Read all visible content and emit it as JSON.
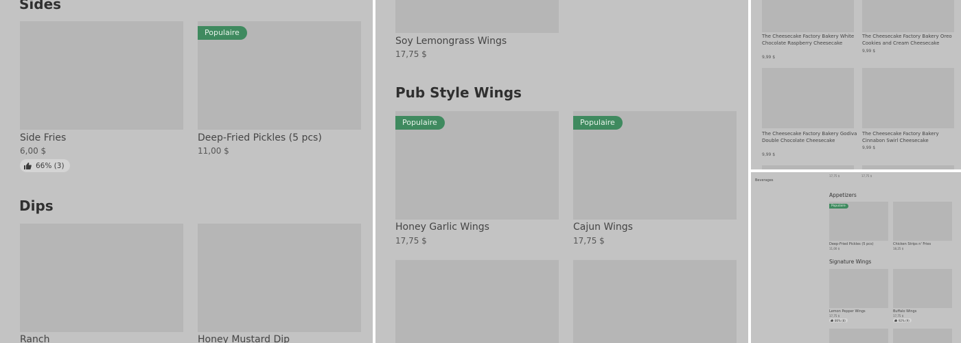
{
  "panel1": {
    "sides_title": "Sides",
    "dips_title": "Dips",
    "popular_badge": "Populaire",
    "side_fries": {
      "name": "Side Fries",
      "price": "6,00 $",
      "rating": "66% (3)"
    },
    "deep_fried_pickles": {
      "name": "Deep-Fried Pickles (5 pcs)",
      "price": "11,00 $"
    },
    "ranch": {
      "name": "Ranch"
    },
    "honey_mustard_dip": {
      "name": "Honey Mustard Dip"
    }
  },
  "panel2": {
    "soy_lemongrass_wings": {
      "name": "Soy Lemongrass Wings",
      "price": "17,75 $"
    },
    "pub_style_title": "Pub Style Wings",
    "popular_badge": "Populaire",
    "honey_garlic_wings": {
      "name": "Honey Garlic Wings",
      "price": "17,75 $"
    },
    "cajun_wings": {
      "name": "Cajun Wings",
      "price": "17,75 $"
    }
  },
  "panel3": {
    "items": [
      {
        "name": "The Cheesecake Factory Bakery White Chocolate Raspberry Cheesecake",
        "price": "9,99 $"
      },
      {
        "name": "The Cheesecake Factory Bakery Oreo Cookies and Cream Cheesecake",
        "price": "9,99 $"
      },
      {
        "name": "The Cheesecake Factory Bakery Godiva Double Chocolate Cheesecake",
        "price": "9,99 $"
      },
      {
        "name": "The Cheesecake Factory Bakery Cinnabon Swirl Cheesecake",
        "price": "9,99 $"
      }
    ]
  },
  "panel4": {
    "sidebar_label": "Beverages",
    "top_prices": [
      "17,75 $",
      "17,75 $"
    ],
    "appetizers_title": "Appetizers",
    "popular_badge": "Populaire",
    "deep_fried_pickles": {
      "name": "Deep-Fried Pickles (5 pcs)",
      "price": "11,00 $"
    },
    "chicken_strips": {
      "name": "Chicken Strips n' Fries",
      "price": "18,25 $"
    },
    "signature_title": "Signature Wings",
    "lemon_pepper_wings": {
      "name": "Lemon Pepper Wings",
      "price": "17,75 $",
      "rating": "86% (8)"
    },
    "buffalo_wings": {
      "name": "Buffalo Wings",
      "price": "17,75 $",
      "rating": "92% (9)"
    }
  },
  "colors": {
    "panel_bg": "#c3c3c3",
    "image_placeholder": "#b6b6b6",
    "popular_badge": "#3f8a5f",
    "text": "#2f2f2f"
  }
}
